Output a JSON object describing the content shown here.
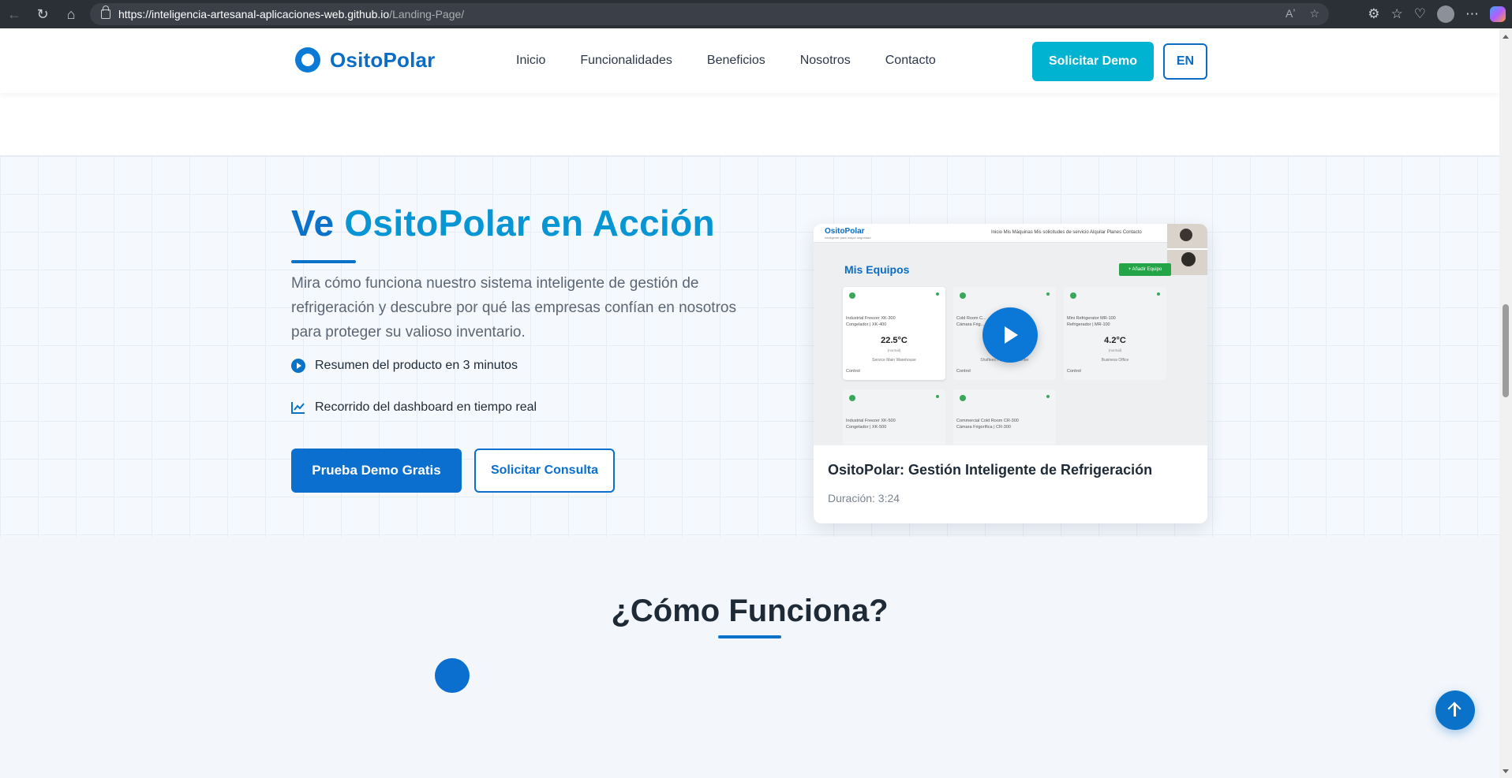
{
  "browser": {
    "url_host": "https://inteligencia-artesanal-aplicaciones-web.github.io",
    "url_path": "/Landing-Page/",
    "icons": [
      "back-icon",
      "refresh-icon",
      "home-icon",
      "lock-icon",
      "read-aloud-icon",
      "favorite-icon",
      "extensions-icon",
      "favorites-icon",
      "health-icon",
      "profile-icon",
      "more-icon",
      "copilot-icon"
    ],
    "read_aloud": "Aʼ",
    "more": "⋯"
  },
  "header": {
    "brand": "OsitoPolar",
    "nav": [
      "Inicio",
      "Funcionalidades",
      "Beneficios",
      "Nosotros",
      "Contacto"
    ],
    "cta": "Solicitar Demo",
    "lang": "EN"
  },
  "hero": {
    "title_a": "Ve ",
    "title_b": "OsitoPolar en Acción",
    "description": "Mira cómo funciona nuestro sistema inteligente de gestión de refrigeración y descubre por qué las empresas confían en nosotros para proteger su valioso inventario.",
    "features": [
      {
        "icon": "play-circle-icon",
        "label": "Resumen del producto en 3 minutos"
      },
      {
        "icon": "chart-line-icon",
        "label": "Recorrido del dashboard en tiempo real"
      }
    ],
    "primary_button": "Prueba Demo Gratis",
    "secondary_button": "Solicitar Consulta"
  },
  "video": {
    "title": "OsitoPolar: Gestión Inteligente de Refrigeración",
    "duration": "Duración: 3:24",
    "preview": {
      "brand": "OsitoPolar",
      "subtitle": "Inteligente para mayor seguridad",
      "nav": "Inicio  Mis Máquinas  Mis solicitudes de servicio  Alquilar  Planes  Contacto",
      "section_title": "Mis Equipos",
      "add_button": "+ Añadir Equipo",
      "cards": [
        {
          "name": "Industrial Freezer XK-300\nCongelador | XK-400",
          "temp": "22.5°C",
          "status": "(normal)",
          "location": "Service Main Warehouse",
          "control": "Control"
        },
        {
          "name": "Cold Room C...\nCámara Frig...",
          "temp": "",
          "status": "",
          "location": "Shaftees Production Center",
          "control": "Control"
        },
        {
          "name": "Mini Refrigerator MR-100\nRefrigerador | MR-100",
          "temp": "4.2°C",
          "status": "(normal)",
          "location": "Business Office",
          "control": "Control"
        },
        {
          "name": "Industrial Freezer XK-500\nCongelador | XK-500",
          "temp": "",
          "status": "",
          "location": "",
          "control": ""
        },
        {
          "name": "Commercial Cold Room CR-300\nCámara Frigorífica | CR-300",
          "temp": "",
          "status": "",
          "location": "",
          "control": ""
        }
      ]
    }
  },
  "how": {
    "title": "¿Cómo Funciona?"
  },
  "colors": {
    "primary": "#0a6fce",
    "accent": "#00b3d1",
    "brand": "#0a6cc4"
  }
}
